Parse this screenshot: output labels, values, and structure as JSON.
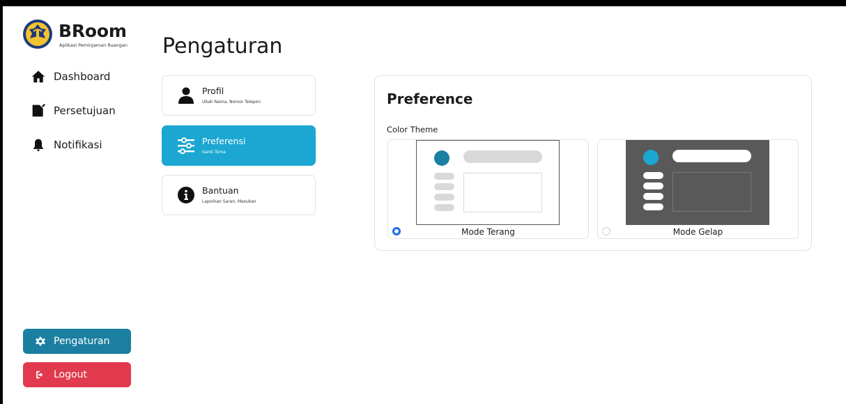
{
  "brand": {
    "title": "BRoom",
    "subtitle": "Aplikasi Peminjaman Ruangan"
  },
  "sidebar": {
    "items": [
      {
        "label": "Dashboard",
        "icon": "home-icon"
      },
      {
        "label": "Persetujuan",
        "icon": "signature-icon"
      },
      {
        "label": "Notifikasi",
        "icon": "bell-icon"
      }
    ],
    "settings_label": "Pengaturan",
    "logout_label": "Logout"
  },
  "page": {
    "title": "Pengaturan"
  },
  "menu": [
    {
      "title": "Profil",
      "subtitle": "Ubah Nama, Nomor Telepon",
      "icon": "user-icon",
      "active": false
    },
    {
      "title": "Preferensi",
      "subtitle": "Ganti Tema",
      "icon": "sliders-icon",
      "active": true
    },
    {
      "title": "Bantuan",
      "subtitle": "Laporkan Saran, Masukan",
      "icon": "info-icon",
      "active": false
    }
  ],
  "preference": {
    "title": "Preference",
    "section_label": "Color Theme",
    "themes": [
      {
        "label": "Mode Terang",
        "selected": true
      },
      {
        "label": "Mode Gelap",
        "selected": false
      }
    ]
  },
  "colors": {
    "primary": "#1b7fa1",
    "active_menu": "#1ba7d1",
    "logout": "#e13a4e",
    "radio_selected": "#1a6fe6",
    "dark_preview": "#595959"
  }
}
